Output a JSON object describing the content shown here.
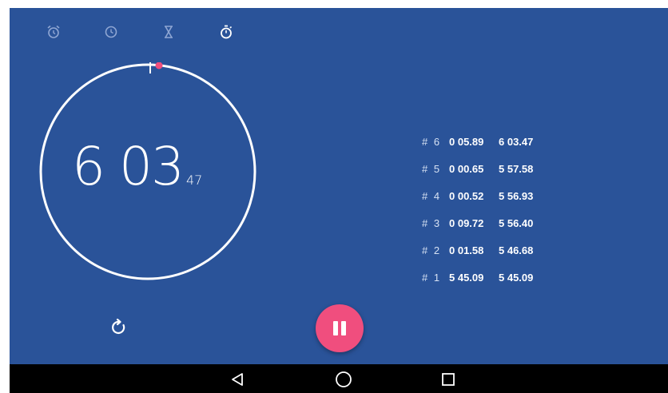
{
  "tabs": [
    {
      "name": "alarm-icon"
    },
    {
      "name": "clock-icon"
    },
    {
      "name": "timer-icon"
    },
    {
      "name": "stopwatch-icon",
      "selected": true
    }
  ],
  "stopwatch": {
    "time_main": "6 03",
    "time_hundredths": "47"
  },
  "laps": [
    {
      "num": "# 6",
      "split": "0 05.89",
      "total": "6 03.47"
    },
    {
      "num": "# 5",
      "split": "0 00.65",
      "total": "5 57.58"
    },
    {
      "num": "# 4",
      "split": "0 00.52",
      "total": "5 56.93"
    },
    {
      "num": "# 3",
      "split": "0 09.72",
      "total": "5 56.40"
    },
    {
      "num": "# 2",
      "split": "0 01.58",
      "total": "5 46.68"
    },
    {
      "num": "# 1",
      "split": "5 45.09",
      "total": "5 45.09"
    }
  ],
  "controls": {
    "reset_icon": "reset-icon",
    "pause_icon": "pause-icon"
  },
  "navbar": {
    "back_icon": "back-icon",
    "home_icon": "home-icon",
    "recents_icon": "recents-icon"
  },
  "colors": {
    "background": "#2a5399",
    "accent": "#f04e7e",
    "navbar": "#000000"
  }
}
